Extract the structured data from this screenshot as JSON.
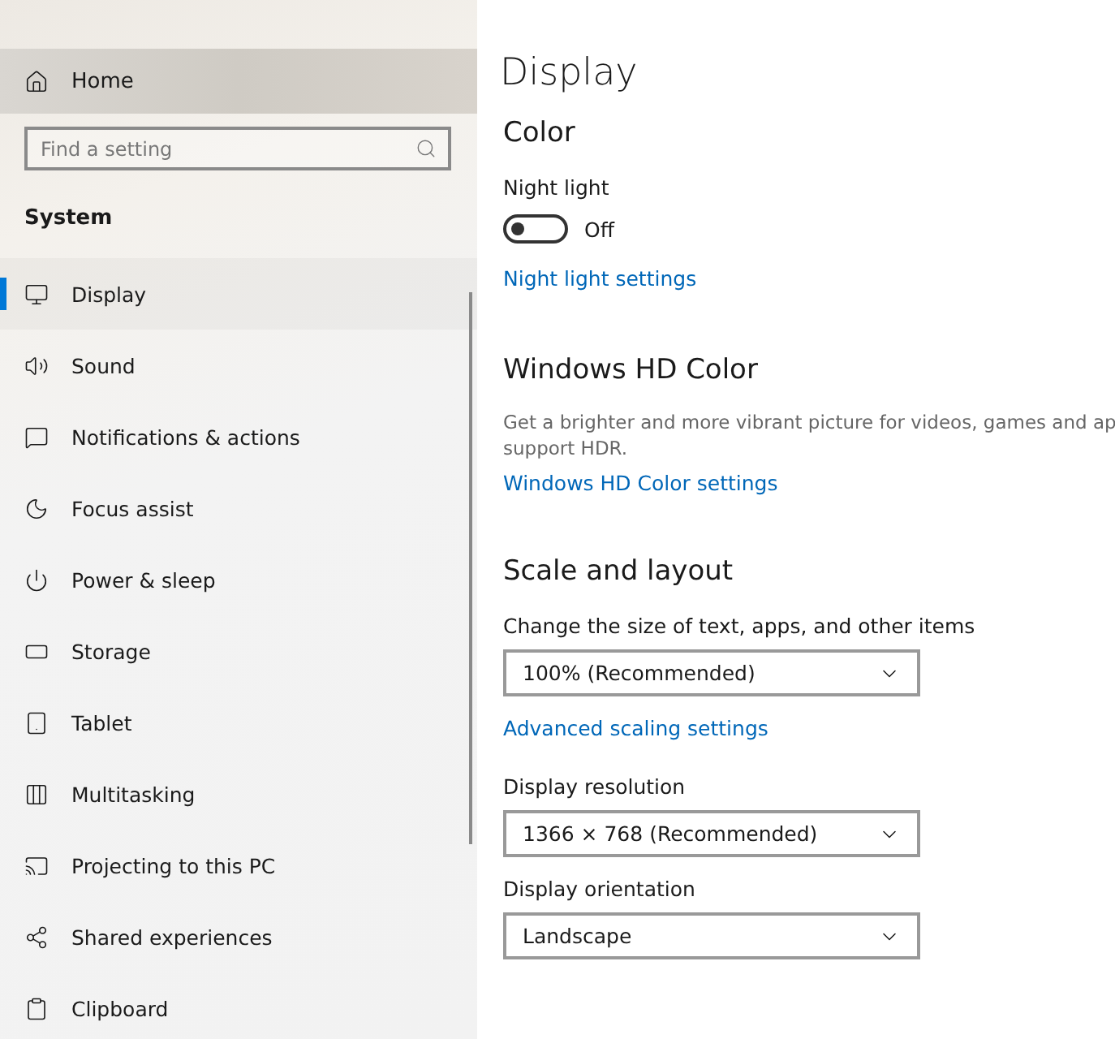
{
  "sidebar": {
    "home": "Home",
    "search": {
      "placeholder": "Find a setting"
    },
    "section": "System",
    "items": [
      {
        "label": "Display",
        "selected": true
      },
      {
        "label": "Sound",
        "selected": false
      },
      {
        "label": "Notifications & actions",
        "selected": false
      },
      {
        "label": "Focus assist",
        "selected": false
      },
      {
        "label": "Power & sleep",
        "selected": false
      },
      {
        "label": "Storage",
        "selected": false
      },
      {
        "label": "Tablet",
        "selected": false
      },
      {
        "label": "Multitasking",
        "selected": false
      },
      {
        "label": "Projecting to this PC",
        "selected": false
      },
      {
        "label": "Shared experiences",
        "selected": false
      },
      {
        "label": "Clipboard",
        "selected": false
      }
    ]
  },
  "content": {
    "title": "Display",
    "color": {
      "heading": "Color",
      "night_light": {
        "label": "Night light",
        "on": false,
        "state_text": "Off"
      },
      "link": "Night light settings"
    },
    "hd_color": {
      "heading": "Windows HD Color",
      "description_lines": [
        "Get a brighter and more vibrant picture for videos, games and ap",
        "support HDR."
      ],
      "link": "Windows HD Color settings"
    },
    "scale": {
      "heading": "Scale and layout",
      "size_label": "Change the size of text, apps, and other items",
      "size_value": "100% (Recommended)",
      "link": "Advanced scaling settings",
      "resolution_label": "Display resolution",
      "resolution_value": "1366 × 768 (Recommended)",
      "orientation_label": "Display orientation",
      "orientation_value": "Landscape"
    }
  }
}
